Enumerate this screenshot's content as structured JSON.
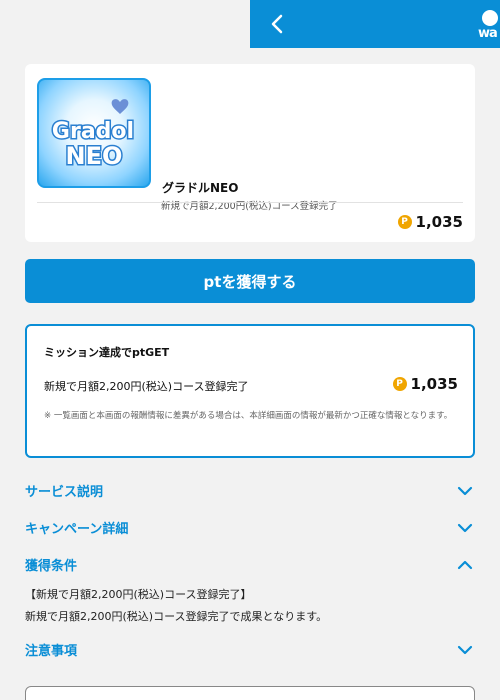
{
  "header": {
    "logo_text": "wa"
  },
  "product": {
    "name": "グラドルNEO",
    "description": "新規で月額2,200円(税込)コース登録完了",
    "image_text_top": "Gradol",
    "image_text_bottom": "NEO",
    "points": "1,035",
    "coin_symbol": "P"
  },
  "get_button": {
    "label": "ptを獲得する"
  },
  "mission": {
    "title": "ミッション達成でptGET",
    "condition": "新規で月額2,200円(税込)コース登録完了",
    "points": "1,035",
    "coin_symbol": "P",
    "note": "※ 一覧画面と本画面の報酬情報に差異がある場合は、本詳細画面の情報が最新かつ正確な情報となります。"
  },
  "sections": {
    "service": "サービス説明",
    "campaign": "キャンペーン詳細",
    "conditions": "獲得条件",
    "notes": "注意事項"
  },
  "conditions_detail": {
    "line1": "【新規で月額2,200円(税込)コース登録完了】",
    "line2": "新規で月額2,200円(税込)コース登録完了で成果となります。"
  },
  "colors": {
    "accent": "#0a8ed6",
    "coin": "#f0a500",
    "background": "#f2f2f2"
  }
}
